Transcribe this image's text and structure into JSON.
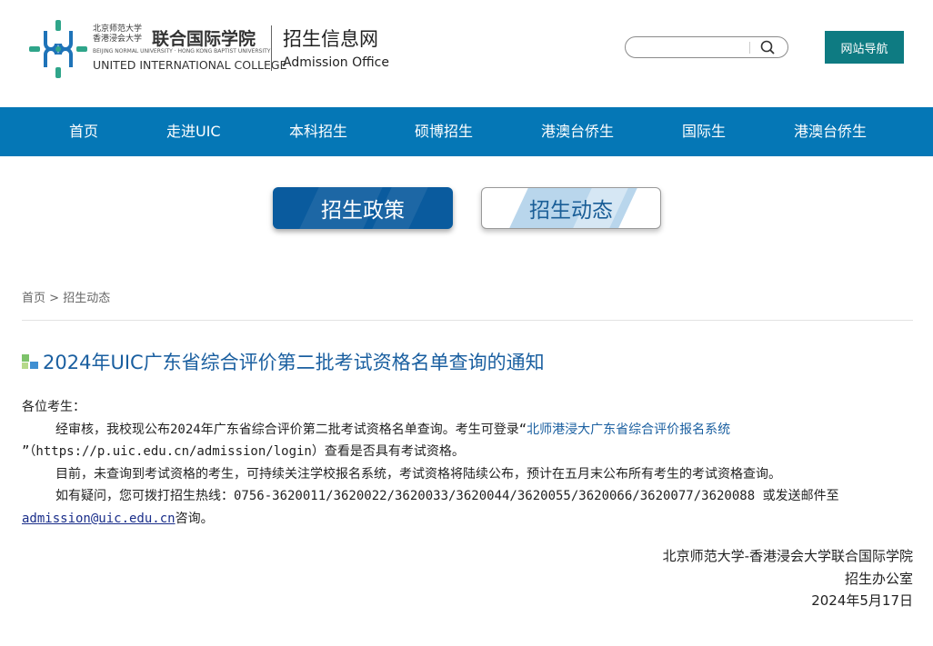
{
  "header": {
    "logo_cn_line1": "北京师范大学",
    "logo_cn_line2": "香港浸会大学",
    "logo_name": "联合国际学院",
    "logo_en_line1": "BEIJING NORMAL UNIVERSITY · HONG KONG BAPTIST UNIVERSITY",
    "logo_en_line2": "UNITED INTERNATIONAL COLLEGE",
    "site_name": "招生信息网",
    "site_sub": "Admission Office",
    "search_placeholder": "",
    "nav_button": "网站导航"
  },
  "navbar": {
    "items": [
      "首页",
      "走进UIC",
      "本科招生",
      "硕博招生",
      "港澳台侨生",
      "国际生",
      "港澳台侨生"
    ]
  },
  "tabs": {
    "active": "招生政策",
    "inactive": "招生动态"
  },
  "breadcrumb": {
    "home": "首页",
    "sep": " > ",
    "current": "招生动态"
  },
  "article": {
    "title": "2024年UIC广东省综合评价第二批考试资格名单查询的通知",
    "greeting": "各位考生：",
    "p1_a": "经审核，我校现公布2024年广东省综合评价第二批考试资格名单查询。考生可登录“",
    "p1_link": "北师港浸大广东省综合评价报名系统",
    "p1_b": "”（https://p.uic.edu.cn/admission/login）查看是否具有考试资格。",
    "p2": "目前，未查询到考试资格的考生，可持续关注学校报名系统，考试资格将陆续公布，预计在五月末公布所有考生的考试资格查询。",
    "p3_a": "如有疑问，您可拨打招生热线：0756-3620011/3620022/3620033/3620044/3620055/3620066/3620077/3620088 或发送邮件至",
    "p3_mail": "admission@uic.edu.cn",
    "p3_b": "咨询。",
    "sign_org": "北京师范大学-香港浸会大学联合国际学院",
    "sign_dept": "招生办公室",
    "sign_date": "2024年5月17日"
  },
  "colors": {
    "navbar": "#0577b6",
    "nav_button": "#0e7b82",
    "tab_active": "#0a5b9e",
    "title": "#1a5fa0",
    "logo_green": "#2fa58a",
    "logo_blue": "#1e73b8"
  }
}
